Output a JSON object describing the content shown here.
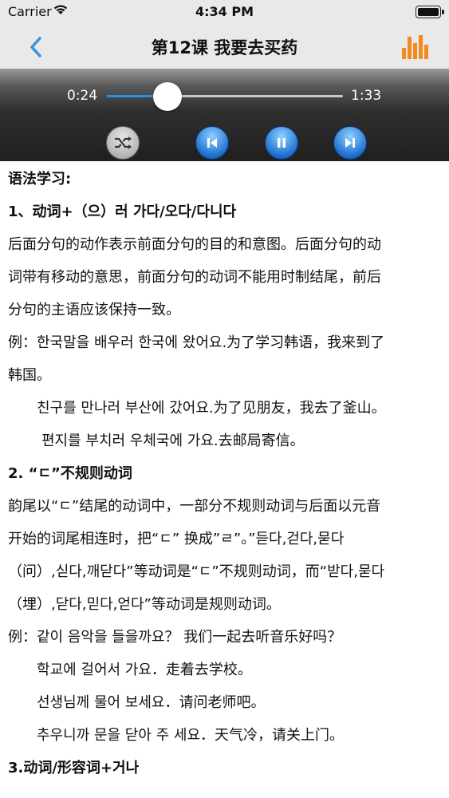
{
  "status_bar": {
    "carrier": "Carrier",
    "time": "4:34 PM"
  },
  "nav": {
    "title": "第12课 我要去买药",
    "back_icon": "chevron-left-icon",
    "stats_icon": "bar-chart-icon",
    "accent_color": "#3a8fd8",
    "stats_color": "#f28a1e"
  },
  "player": {
    "current_time": "0:24",
    "total_time": "1:33",
    "progress": 0.258,
    "controls": [
      "shuffle-icon",
      "previous-icon",
      "pause-icon",
      "next-icon"
    ]
  },
  "content": {
    "heading": "语法学习:",
    "section1_title": "1、动词+（으）러 가다/오다/다니다",
    "section1_desc": [
      "后面分句的动作表示前面分句的目的和意图。后面分句的动",
      "词带有移动的意思，前面分句的动词不能用时制结尾，前后",
      "分句的主语应该保持一致。"
    ],
    "section1_examples": [
      "例：한국말을 배우러 한국에 왔어요.为了学习韩语，我来到了",
      "韩国。",
      "친구를 만나러 부산에 갔어요.为了见朋友，我去了釜山。",
      "편지를 부치러 우체국에 가요.去邮局寄信。"
    ],
    "section2_title": "2. “ㄷ”不规则动词",
    "section2_desc": [
      "韵尾以“ㄷ”结尾的动词中，一部分不规则动词与后面以元音",
      "开始的词尾相连时，把“ㄷ” 换成”ㄹ”。”듣다,걷다,묻다",
      "（问）,싣다,깨닫다”等动词是“ㄷ”不规则动词，而“받다,묻다",
      "（埋）,닫다,믿다,얻다”等动词是规则动词。"
    ],
    "section2_examples": [
      "例：같이 음악을 들을까요？ 我们一起去听音乐好吗？",
      "학교에 걸어서 가요．走着去学校。",
      "선생님께 물어 보세요．请问老师吧。",
      "추우니까 문을 닫아 주 세요．天气冷，请关上门。"
    ],
    "section3_title": "3.动词/形容词+거나"
  }
}
